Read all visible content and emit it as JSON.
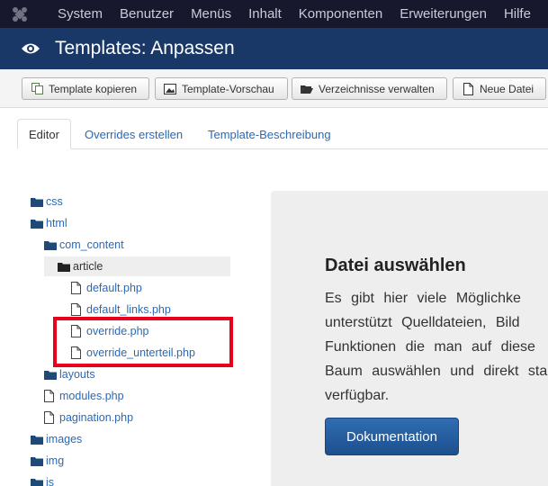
{
  "menu": {
    "items": [
      "System",
      "Benutzer",
      "Menüs",
      "Inhalt",
      "Komponenten",
      "Erweiterungen",
      "Hilfe"
    ]
  },
  "header": {
    "title": "Templates: Anpassen",
    "icon": "eye-icon"
  },
  "toolbar": {
    "copy_label": "Template kopieren",
    "preview_label": "Template-Vorschau",
    "folders_label": "Verzeichnisse verwalten",
    "new_file_label": "Neue Datei"
  },
  "tabs": [
    "Editor",
    "Overrides erstellen",
    "Template-Beschreibung"
  ],
  "tree": {
    "css": "css",
    "html": "html",
    "com_content": "com_content",
    "article": "article",
    "default": "default.php",
    "default_links": "default_links.php",
    "override": "override.php",
    "override_unterteil": "override_unterteil.php",
    "layouts": "layouts",
    "modules": "modules.php",
    "pagination": "pagination.php",
    "images": "images",
    "img": "img",
    "js": "js"
  },
  "panel": {
    "heading": "Datei auswählen",
    "lines": [
      "Es gibt hier viele Möglichke",
      "unterstützt Quelldateien, Bild",
      "Funktionen die man auf diese",
      "Baum auswählen und direkt sta",
      "verfügbar."
    ],
    "button_label": "Dokumentation"
  },
  "colors": {
    "topbar": "#17182e",
    "header": "#1a3867",
    "link": "#2a69b8",
    "highlight": "#e8001c",
    "button": "#1d4f8d"
  }
}
